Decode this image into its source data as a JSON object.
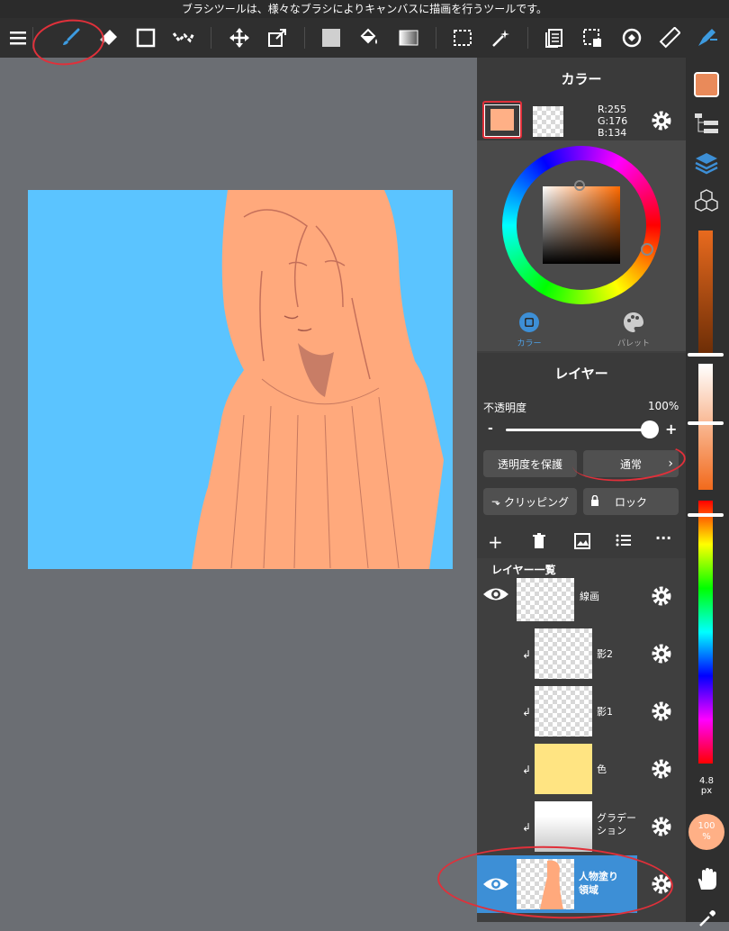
{
  "tooltip": "ブラシツールは、様々なブラシによりキャンバスに描画を行うツールです。",
  "color_panel": {
    "title": "カラー",
    "rgb_r": "R:255",
    "rgb_g": "G:176",
    "rgb_b": "B:134",
    "tab_color": "カラー",
    "tab_palette": "パレット",
    "primary_color": "#ffb086"
  },
  "layer_panel": {
    "title": "レイヤー",
    "opacity_label": "不透明度",
    "opacity_value": "100%",
    "opacity_fraction": 1.0,
    "minus": "-",
    "plus": "+",
    "protect_alpha": "透明度を保護",
    "blend_mode": "通常",
    "clipping": "クリッピング",
    "lock": "ロック",
    "list_title": "レイヤー一覧",
    "layers": [
      {
        "name": "線画"
      },
      {
        "name": "影2"
      },
      {
        "name": "影1"
      },
      {
        "name": "色"
      },
      {
        "name": "グラデーション"
      },
      {
        "name": "人物塗り領域"
      }
    ]
  },
  "right_strip": {
    "brush_size_value": "4.8",
    "brush_size_unit": "px",
    "opacity_badge": "100",
    "opacity_unit": "%"
  },
  "colors": {
    "canvas_bg": "#5bc4ff",
    "accent": "#3d8fd6",
    "selected_layer": "#3d8fd6",
    "annotation": "#e0303a"
  }
}
